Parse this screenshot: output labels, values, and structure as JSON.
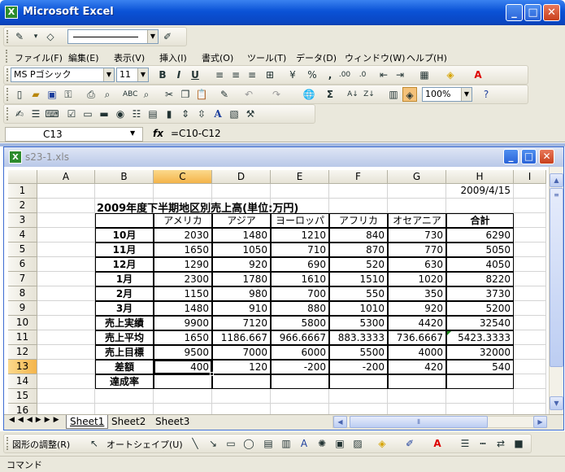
{
  "window": {
    "title": "Microsoft Excel",
    "minimize": "_",
    "maximize": "□",
    "close": "✕"
  },
  "menu": [
    "ファイル(F)",
    "編集(E)",
    "表示(V)",
    "挿入(I)",
    "書式(O)",
    "ツール(T)",
    "データ(D)",
    "ウィンドウ(W)",
    "ヘルプ(H)"
  ],
  "format_toolbar": {
    "font": "MS Pゴシック",
    "size": "11",
    "bold": "B",
    "italic": "I",
    "underline": "U",
    "percent": "%",
    "comma": ","
  },
  "standard_toolbar": {
    "zoom": "100%",
    "sigma": "Σ"
  },
  "formula_bar": {
    "name_box": "C13",
    "fx": "fx",
    "formula": "=C10-C12"
  },
  "workbook": {
    "title": "s23-1.xls",
    "columns": [
      "A",
      "B",
      "C",
      "D",
      "E",
      "F",
      "G",
      "H",
      "I"
    ],
    "rows": [
      "1",
      "2",
      "3",
      "4",
      "5",
      "6",
      "7",
      "8",
      "9",
      "10",
      "11",
      "12",
      "13",
      "14",
      "15",
      "16"
    ],
    "date": "2009/4/15",
    "heading": "2009年度下半期地区別売上高(単位:万円)",
    "headers": [
      "アメリカ",
      "アジア",
      "ヨーロッパ",
      "アフリカ",
      "オセアニア",
      "合計"
    ],
    "table": [
      {
        "label": "10月",
        "values": [
          "2030",
          "1480",
          "1210",
          "840",
          "730",
          "6290"
        ]
      },
      {
        "label": "11月",
        "values": [
          "1650",
          "1050",
          "710",
          "870",
          "770",
          "5050"
        ]
      },
      {
        "label": "12月",
        "values": [
          "1290",
          "920",
          "690",
          "520",
          "630",
          "4050"
        ]
      },
      {
        "label": "1月",
        "values": [
          "2300",
          "1780",
          "1610",
          "1510",
          "1020",
          "8220"
        ]
      },
      {
        "label": "2月",
        "values": [
          "1150",
          "980",
          "700",
          "550",
          "350",
          "3730"
        ]
      },
      {
        "label": "3月",
        "values": [
          "1480",
          "910",
          "880",
          "1010",
          "920",
          "5200"
        ]
      },
      {
        "label": "売上実績",
        "values": [
          "9900",
          "7120",
          "5800",
          "5300",
          "4420",
          "32540"
        ]
      },
      {
        "label": "売上平均",
        "values": [
          "1650",
          "1186.667",
          "966.6667",
          "883.3333",
          "736.6667",
          "5423.3333"
        ]
      },
      {
        "label": "売上目標",
        "values": [
          "9500",
          "7000",
          "6000",
          "5500",
          "4000",
          "32000"
        ]
      },
      {
        "label": "差額",
        "values": [
          "400",
          "120",
          "-200",
          "-200",
          "420",
          "540"
        ]
      },
      {
        "label": "達成率",
        "values": [
          "",
          "",
          "",
          "",
          "",
          ""
        ]
      }
    ],
    "sheets": [
      "Sheet1",
      "Sheet2",
      "Sheet3"
    ]
  },
  "drawing_toolbar": {
    "adjust": "図形の調整(R)",
    "autoshape": "オートシェイプ(U)"
  },
  "status": "コマンド"
}
